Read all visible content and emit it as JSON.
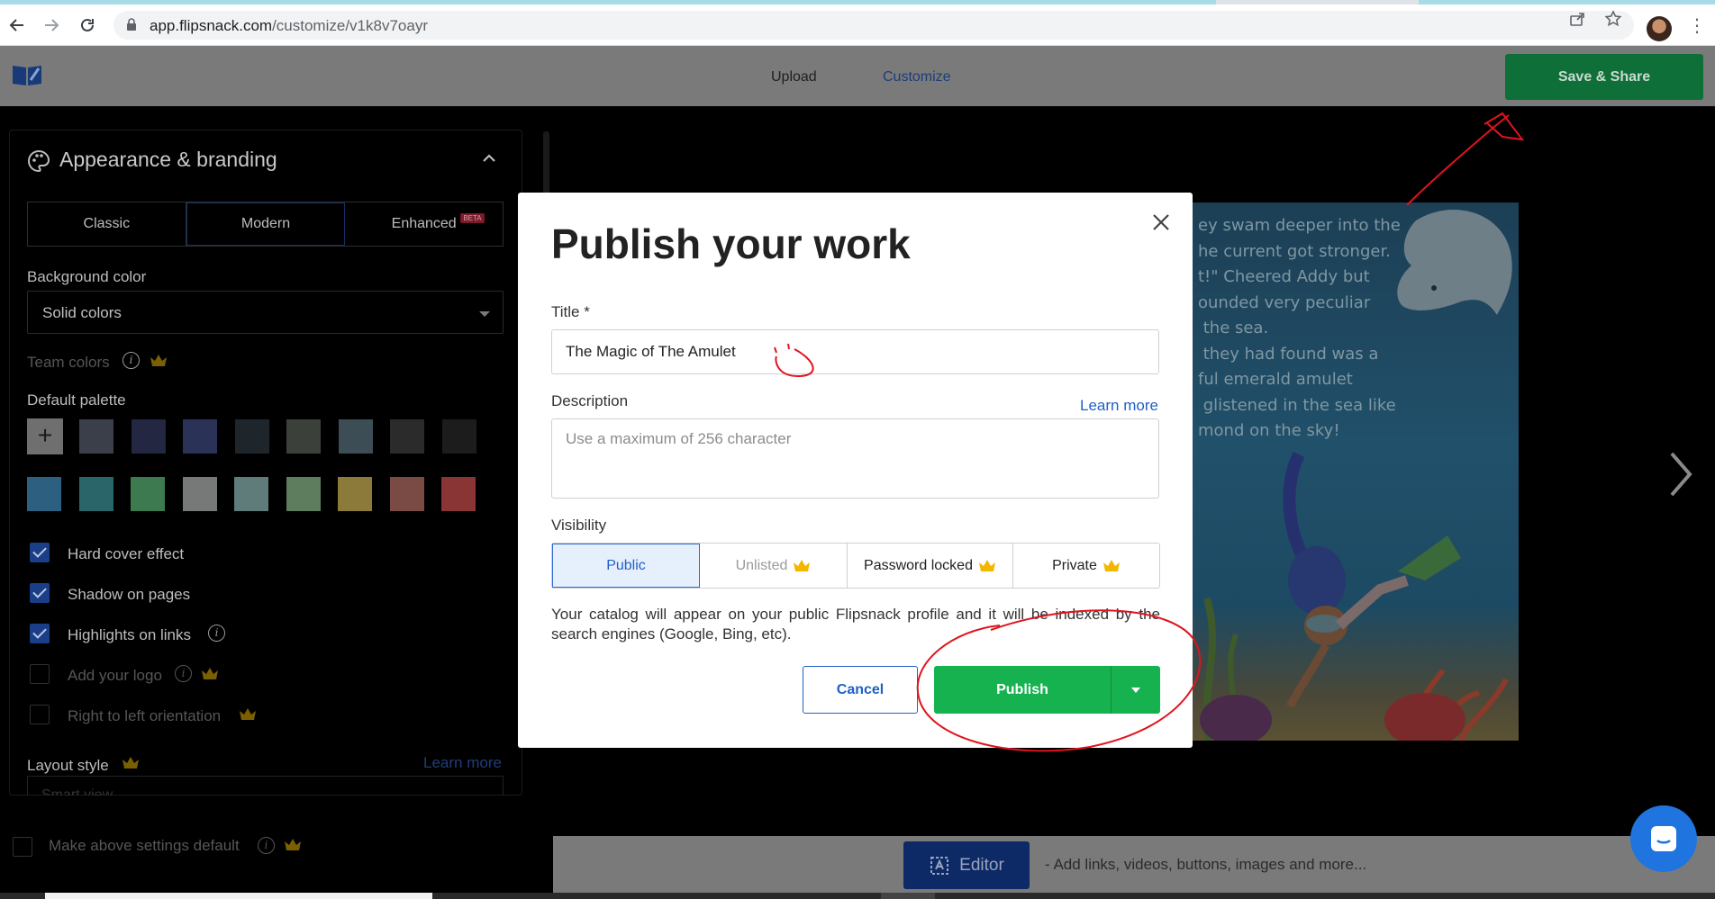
{
  "browser": {
    "url_host": "app.flipsnack.com",
    "url_path": "/customize/v1k8v7oayr"
  },
  "header": {
    "tabs": [
      "Upload",
      "Customize"
    ],
    "save_share_label": "Save & Share"
  },
  "sidebar": {
    "section_title": "Appearance & branding",
    "style_tabs": [
      "Classic",
      "Modern",
      "Enhanced"
    ],
    "beta_badge": "BETA",
    "background_color_label": "Background color",
    "background_color_value": "Solid colors",
    "team_colors_label": "Team colors",
    "default_palette_label": "Default palette",
    "palette_row1": [
      "#3a3f49",
      "#232741",
      "#2b3258",
      "#1e262c",
      "#3b403b",
      "#3c4d55",
      "#2b2b2b",
      "#1c1c1c"
    ],
    "palette_row2": [
      "#2c5f80",
      "#2a6669",
      "#3e7a4f",
      "#777878",
      "#5f7c7a",
      "#5e7d5f",
      "#8c7a3a",
      "#7a4a45",
      "#8a3535"
    ],
    "options": [
      {
        "label": "Hard cover effect",
        "checked": true
      },
      {
        "label": "Shadow on pages",
        "checked": true
      },
      {
        "label": "Highlights on links",
        "checked": true
      },
      {
        "label": "Add your logo",
        "checked": false
      },
      {
        "label": "Right to left orientation",
        "checked": false
      }
    ],
    "layout_style_label": "Layout style",
    "layout_learn_more": "Learn more",
    "layout_value_partial": "Smart view",
    "make_default_label": "Make above settings default"
  },
  "book_page_text": "ey swam deeper into the\nhe current got stronger.\nt!\" Cheered Addy but\nounded very peculiar\n the sea.\n they had found was a\nful emerald amulet\n glistened in the sea like\nmond on the sky!",
  "bottom_bar": {
    "editor_label": "Editor",
    "hint": "- Add links, videos, buttons, images and more..."
  },
  "modal": {
    "title": "Publish your work",
    "title_label": "Title *",
    "title_value": "The Magic of The Amulet",
    "description_label": "Description",
    "description_learn_more": "Learn more",
    "description_placeholder": "Use a maximum of 256 character",
    "visibility_label": "Visibility",
    "visibility_options": [
      "Public",
      "Unlisted",
      "Password locked",
      "Private"
    ],
    "visibility_selected": "Public",
    "visibility_note": "Your catalog will appear on your public Flipsnack profile and it will be indexed by the search engines (Google, Bing, etc).",
    "cancel_label": "Cancel",
    "publish_label": "Publish"
  },
  "colors": {
    "accent_blue": "#1f60c7",
    "publish_green": "#16b24f",
    "save_green": "#0e6f38",
    "annotation_red": "#e0141e",
    "crown": "#f3b700"
  }
}
